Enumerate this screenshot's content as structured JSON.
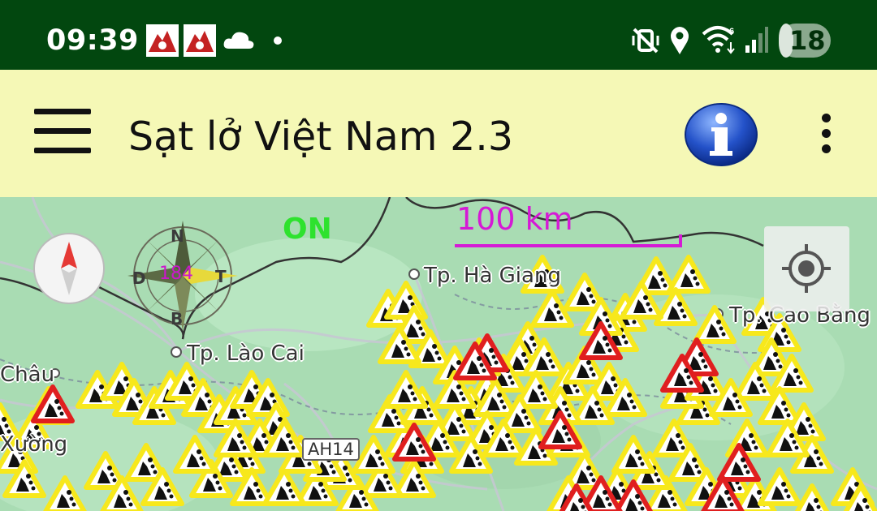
{
  "status_bar": {
    "time": "09:39",
    "battery_level": "18",
    "left_icons": [
      "app-notification-icon",
      "app-notification-icon",
      "cloud-icon",
      "dot-icon"
    ],
    "right_icons": [
      "vibrate-mute-icon",
      "location-icon",
      "wifi-6-icon",
      "signal-icon",
      "battery-icon"
    ]
  },
  "app_bar": {
    "title": "Sạt lở Việt Nam 2.3",
    "menu_icon": "hamburger-menu-icon",
    "info_icon": "info-icon",
    "more_icon": "more-vert-icon"
  },
  "map": {
    "mode_label": "ON",
    "scale_label": "100 km",
    "rose_value": "184",
    "road_label": "AH14",
    "places": {
      "ha_giang": "Tp. Hà Giang",
      "cao_bang": "Tp. Cao Bằng",
      "lao_cai": "Tp. Lào Cai",
      "chau": "Châu",
      "xuong": "Xường"
    },
    "marker_legend": {
      "yellow": "landslide warning",
      "red": "landslide high risk"
    },
    "colors": {
      "warning_yellow": "#f7e81c",
      "danger_red": "#e01f1f",
      "scale_magenta": "#d51ad5",
      "on_green": "#2ee22e"
    }
  }
}
